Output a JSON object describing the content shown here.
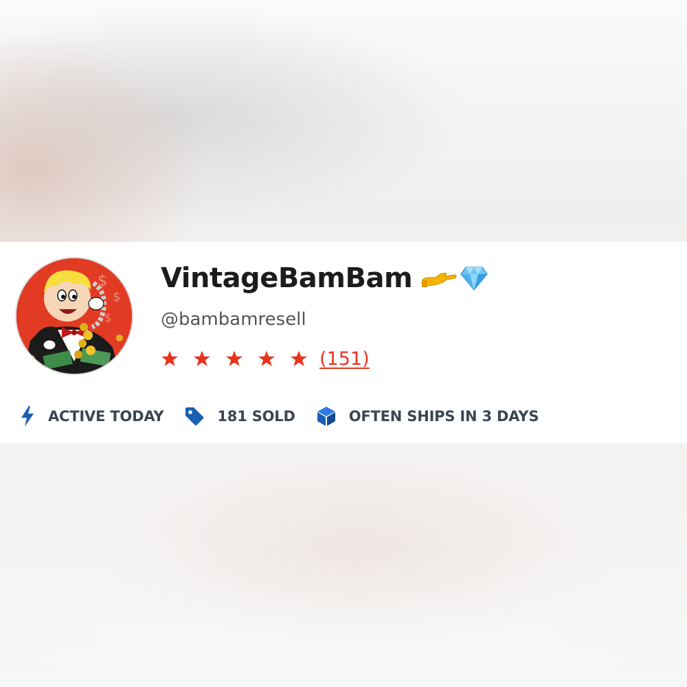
{
  "profile": {
    "display_name": "VintageBamBam",
    "name_emojis": [
      "hand-icon",
      "gem-icon"
    ],
    "username": "@bambamresell",
    "rating": {
      "stars": 5,
      "max_stars": 5,
      "review_count": "(151)",
      "star_color": "#e8341f"
    }
  },
  "stats": [
    {
      "icon": "lightning-icon",
      "label": "ACTIVE TODAY"
    },
    {
      "icon": "tag-icon",
      "label": "181 SOLD"
    },
    {
      "icon": "box-icon",
      "label": "OFTEN SHIPS IN 3 DAYS"
    }
  ],
  "colors": {
    "accent_red": "#e8341f",
    "icon_blue": "#1a5fb4",
    "text_dark": "#1c1c1c",
    "text_muted": "#555555",
    "stat_text": "#3c4650"
  }
}
